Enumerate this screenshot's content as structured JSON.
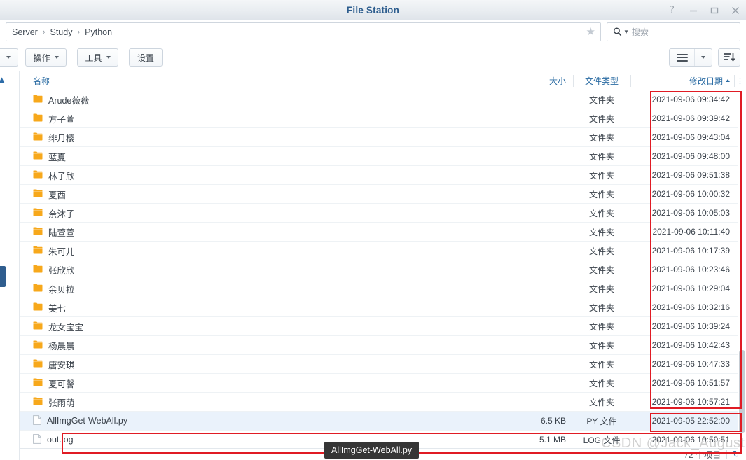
{
  "window": {
    "title": "File Station",
    "controls": [
      {
        "name": "help-icon",
        "glyph": "?"
      },
      {
        "name": "minimize-icon",
        "glyph": "–"
      },
      {
        "name": "maximize-icon",
        "glyph": "□"
      },
      {
        "name": "close-icon",
        "glyph": "✕"
      }
    ]
  },
  "address": {
    "breadcrumb": [
      "Server",
      "Study",
      "Python"
    ],
    "separator": "›",
    "favorite_icon": "star-icon"
  },
  "search": {
    "placeholder": "搜索",
    "icon": "search-icon"
  },
  "toolbar": {
    "first_label": "",
    "actions_label": "操作",
    "tools_label": "工具",
    "settings_label": "设置",
    "view_icon": "list-view-icon",
    "view_caret_icon": "chevron-down-icon",
    "sort_icon": "sort-descending-icon"
  },
  "table": {
    "columns": {
      "name": "名称",
      "size": "大小",
      "type": "文件类型",
      "date": "修改日期",
      "sort_indicator": "▲",
      "menu_icon": "column-options-icon"
    },
    "folder_type_label": "文件夹",
    "rows": [
      {
        "name": "Arude薇薇",
        "kind": "folder",
        "size": "",
        "type": "文件夹",
        "date": "2021-09-06 09:34:42"
      },
      {
        "name": "方子萱",
        "kind": "folder",
        "size": "",
        "type": "文件夹",
        "date": "2021-09-06 09:39:42"
      },
      {
        "name": "绯月樱",
        "kind": "folder",
        "size": "",
        "type": "文件夹",
        "date": "2021-09-06 09:43:04"
      },
      {
        "name": "蓝夏",
        "kind": "folder",
        "size": "",
        "type": "文件夹",
        "date": "2021-09-06 09:48:00"
      },
      {
        "name": "林子欣",
        "kind": "folder",
        "size": "",
        "type": "文件夹",
        "date": "2021-09-06 09:51:38"
      },
      {
        "name": "夏西",
        "kind": "folder",
        "size": "",
        "type": "文件夹",
        "date": "2021-09-06 10:00:32"
      },
      {
        "name": "奈沐子",
        "kind": "folder",
        "size": "",
        "type": "文件夹",
        "date": "2021-09-06 10:05:03"
      },
      {
        "name": "陆萱萱",
        "kind": "folder",
        "size": "",
        "type": "文件夹",
        "date": "2021-09-06 10:11:40"
      },
      {
        "name": "朱可儿",
        "kind": "folder",
        "size": "",
        "type": "文件夹",
        "date": "2021-09-06 10:17:39"
      },
      {
        "name": "张欣欣",
        "kind": "folder",
        "size": "",
        "type": "文件夹",
        "date": "2021-09-06 10:23:46"
      },
      {
        "name": "余贝拉",
        "kind": "folder",
        "size": "",
        "type": "文件夹",
        "date": "2021-09-06 10:29:04"
      },
      {
        "name": "美七",
        "kind": "folder",
        "size": "",
        "type": "文件夹",
        "date": "2021-09-06 10:32:16"
      },
      {
        "name": "龙女宝宝",
        "kind": "folder",
        "size": "",
        "type": "文件夹",
        "date": "2021-09-06 10:39:24"
      },
      {
        "name": "杨晨晨",
        "kind": "folder",
        "size": "",
        "type": "文件夹",
        "date": "2021-09-06 10:42:43"
      },
      {
        "name": "唐安琪",
        "kind": "folder",
        "size": "",
        "type": "文件夹",
        "date": "2021-09-06 10:47:33"
      },
      {
        "name": "夏可馨",
        "kind": "folder",
        "size": "",
        "type": "文件夹",
        "date": "2021-09-06 10:51:57"
      },
      {
        "name": "张雨萌",
        "kind": "folder",
        "size": "",
        "type": "文件夹",
        "date": "2021-09-06 10:57:21"
      },
      {
        "name": "AllImgGet-WebAll.py",
        "kind": "file",
        "size": "6.5 KB",
        "type": "PY 文件",
        "date": "2021-09-05 22:52:00",
        "selected": true
      },
      {
        "name": "out.log",
        "kind": "file",
        "size": "5.1 MB",
        "type": "LOG 文件",
        "date": "2021-09-06 10:59:51"
      }
    ]
  },
  "tooltip": {
    "text": "AllImgGet-WebAll.py"
  },
  "statusbar": {
    "count_label": "72 个项目",
    "refresh_icon": "refresh-icon"
  },
  "watermark": {
    "text": "CSDN @Jack_August"
  },
  "colors": {
    "accent": "#2b6ca3",
    "title": "#2d5d8e",
    "folder": "#f7a81b",
    "annotation": "#e01b24",
    "selection": "#eaf2fb"
  }
}
